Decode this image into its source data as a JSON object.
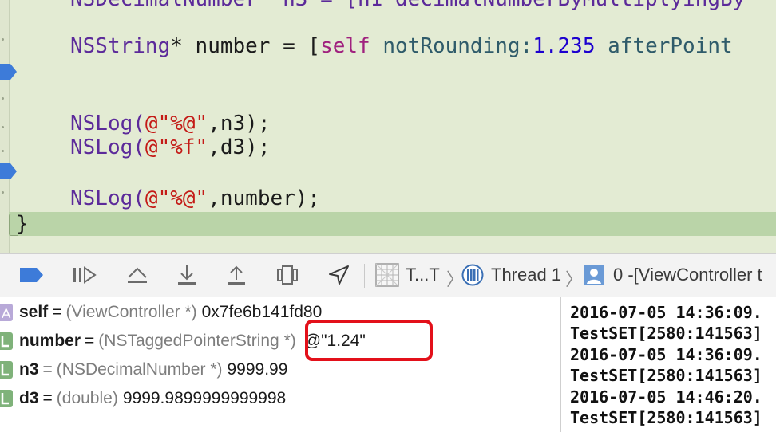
{
  "editor": {
    "partial_line": "NSDecimalNumber* n3 = [n1 decimalNumberByMultiplyingBy",
    "line_number_string": {
      "type": "NSString",
      "star": "*",
      "rest": " number = [",
      "self": "self",
      "method": " notRounding:",
      "num": "1.235",
      "tail": " afterPoint"
    },
    "log1": {
      "fn": "NSLog(",
      "str": "@\"%@\"",
      "tail": ",n3);"
    },
    "log2": {
      "fn": "NSLog(",
      "str": "@\"%f\"",
      "tail": ",d3);"
    },
    "log3": {
      "fn": "NSLog(",
      "str": "@\"%@\"",
      "tail": ",number);"
    },
    "closing_brace": "}"
  },
  "toolbar": {
    "thread_group_label": "T...T",
    "thread_label": "Thread 1",
    "frame_label": "0 -[ViewController t"
  },
  "variables": [
    {
      "icon": "A",
      "name": "self",
      "eq": "=",
      "type": "(ViewController *)",
      "value": "0x7fe6b141fd80"
    },
    {
      "icon": "L",
      "name": "number",
      "eq": "=",
      "type": "(NSTaggedPointerString *)",
      "value": "@\"1.24\""
    },
    {
      "icon": "L",
      "name": "n3",
      "eq": "=",
      "type": "(NSDecimalNumber *)",
      "value": "9999.99"
    },
    {
      "icon": "L",
      "name": "d3",
      "eq": "=",
      "type": "(double)",
      "value": "9999.9899999999998"
    }
  ],
  "console": [
    "2016-07-05 14:36:09.",
    "TestSET[2580:141563]",
    "2016-07-05 14:36:09.",
    "TestSET[2580:141563]",
    "2016-07-05 14:46:20.",
    "TestSET[2580:141563]"
  ],
  "colors": {
    "editor_bg": "#e3ebd3",
    "current_line": "#bad4a8",
    "breakpoint": "#3d7bd9",
    "highlight_box": "#e3101a",
    "keyword_type": "#5c2a9a",
    "string": "#c41a16",
    "number": "#1c00cf"
  }
}
